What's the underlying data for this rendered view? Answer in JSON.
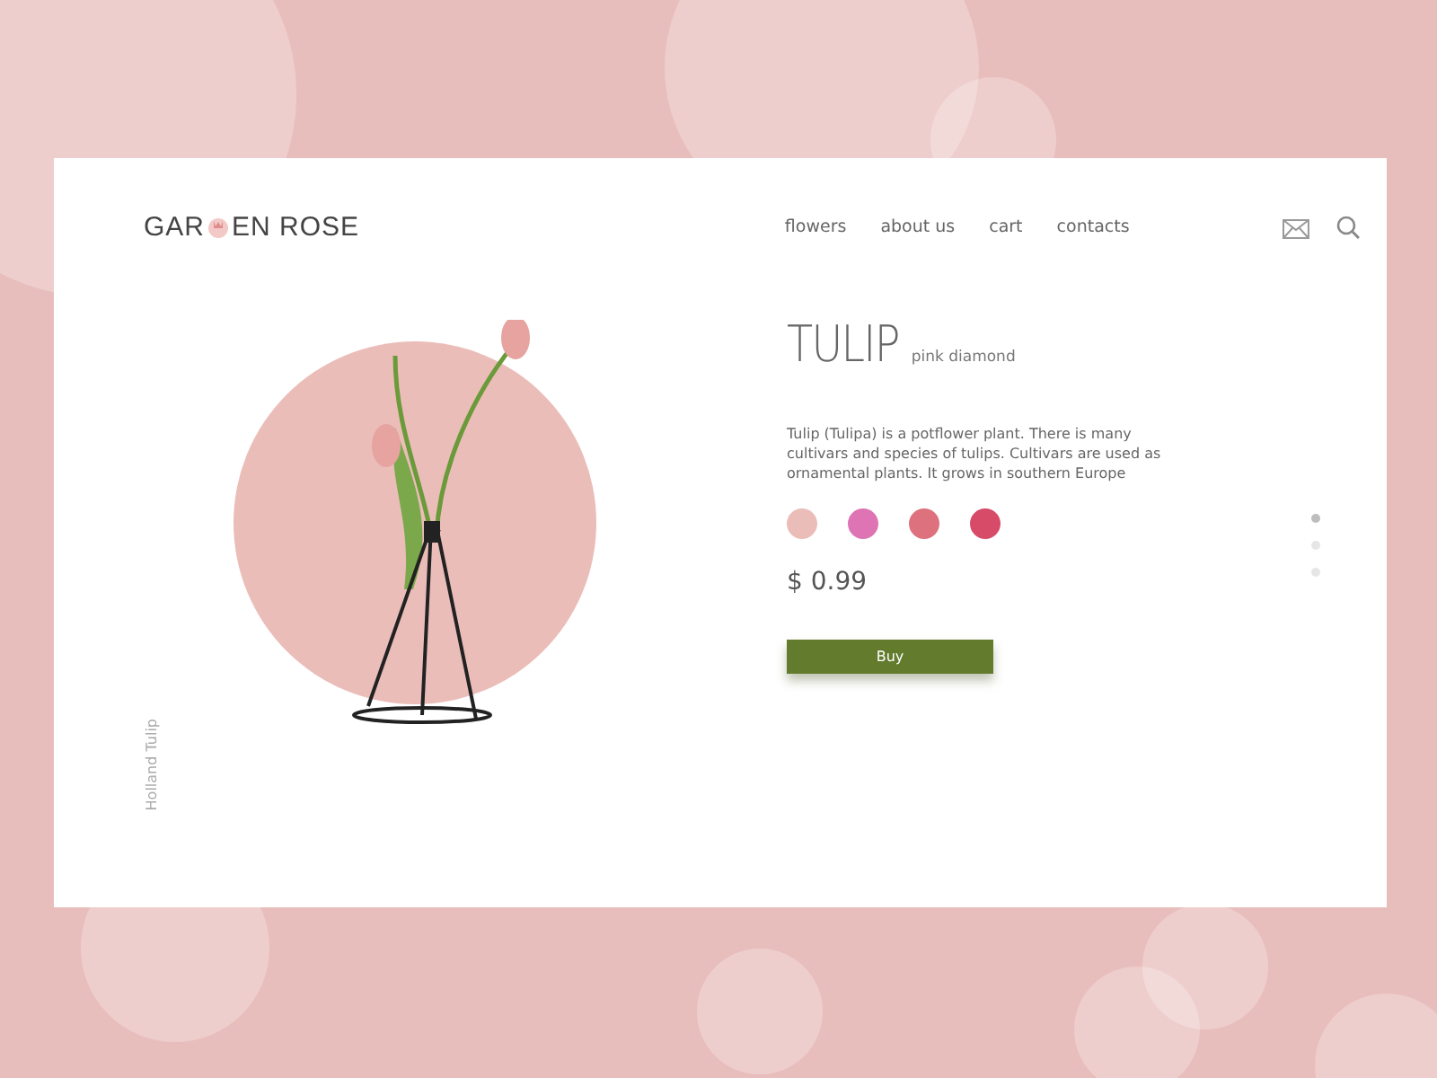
{
  "logo": {
    "before": "GAR",
    "after": "EN ROSE"
  },
  "nav": [
    {
      "label": "flowers"
    },
    {
      "label": "about us"
    },
    {
      "label": "cart"
    },
    {
      "label": "contacts"
    }
  ],
  "product": {
    "name": "TULIP",
    "variety": "pink diamond",
    "description": "Tulip (Tulipa) is a potflower plant. There is many cultivars and species of tulips. Cultivars are used as ornamental plants. It grows in southern Europe",
    "price": "$ 0.99",
    "buy": "Buy"
  },
  "colors": [
    {
      "color": "#ebbdb9"
    },
    {
      "color": "#de74b4"
    },
    {
      "color": "#dd717d"
    },
    {
      "color": "#d74a68"
    }
  ],
  "side_label": "Holland Tulip",
  "pages": [
    {
      "selected": true
    },
    {
      "selected": false
    },
    {
      "selected": false
    }
  ]
}
